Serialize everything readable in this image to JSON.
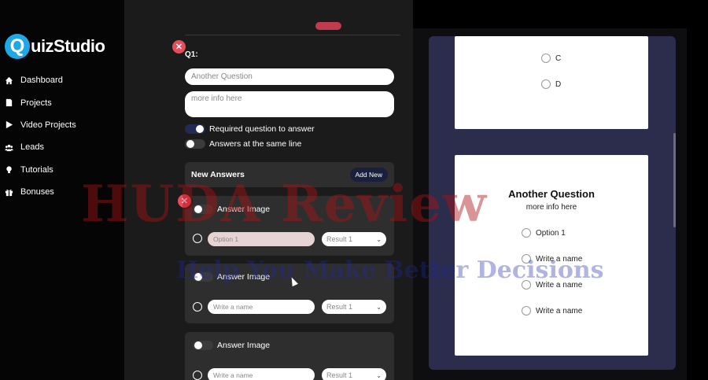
{
  "app": {
    "logo_q": "Q",
    "logo_text": "uizStudio"
  },
  "sidebar": {
    "items": [
      {
        "label": "Dashboard",
        "icon": "home-icon"
      },
      {
        "label": "Projects",
        "icon": "document-icon"
      },
      {
        "label": "Video Projects",
        "icon": "play-icon"
      },
      {
        "label": "Leads",
        "icon": "users-icon"
      },
      {
        "label": "Tutorials",
        "icon": "lightbulb-icon"
      },
      {
        "label": "Bonuses",
        "icon": "gift-icon"
      }
    ]
  },
  "editor": {
    "question_label": "Q1:",
    "question_placeholder": "Another Question",
    "info_placeholder": "more info here",
    "toggles": [
      {
        "label": "Required question to answer",
        "on": true
      },
      {
        "label": "Answers at the same line",
        "on": false
      }
    ],
    "answers_title": "New Answers",
    "add_new_label": "Add New",
    "answer_cards": [
      {
        "image_label": "Answer Image",
        "name": "Option 1",
        "result": "Result 1"
      },
      {
        "image_label": "Answer Image",
        "name": "Write a name",
        "result": "Result 1"
      },
      {
        "image_label": "Answer Image",
        "name": "Write a name",
        "result": "Result 1"
      }
    ]
  },
  "preview": {
    "top_options": [
      "C",
      "D"
    ],
    "title": "Another Question",
    "subtitle": "more info here",
    "options": [
      "Option 1",
      "Write a name",
      "Write a name",
      "Write a name"
    ]
  },
  "watermark": {
    "main": "HUDA Review",
    "tagline": "Help You Make Better Decisions"
  },
  "colors": {
    "accent": "#1ea8e6",
    "delete": "#e74c5b",
    "preview_bg": "#2c2c4d",
    "add_new_bg": "#1a1f3d"
  }
}
